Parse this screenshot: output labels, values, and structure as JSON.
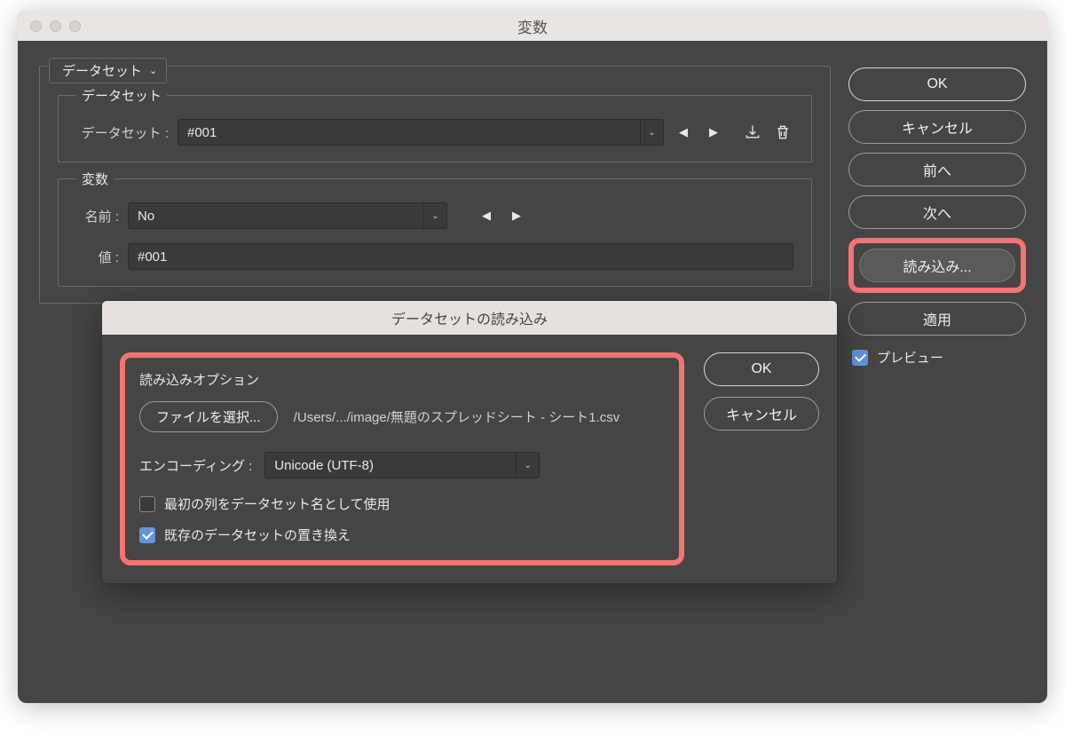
{
  "window": {
    "title": "変数"
  },
  "tab": {
    "label": "データセット",
    "has_menu": true
  },
  "dataset_group": {
    "legend": "データセット",
    "field_label": "データセット :",
    "value": "#001"
  },
  "variable_group": {
    "legend": "変数",
    "name_label": "名前 :",
    "name_value": "No",
    "value_label": "値 :",
    "value_value": "#001"
  },
  "sidebar": {
    "ok": "OK",
    "cancel": "キャンセル",
    "prev": "前へ",
    "next": "次へ",
    "import": "読み込み...",
    "apply": "適用",
    "preview_label": "プレビュー",
    "preview_checked": true
  },
  "modal": {
    "title": "データセットの読み込み",
    "options_legend": "読み込みオプション",
    "choose_file": "ファイルを選択...",
    "filepath": "/Users/.../image/無題のスプレッドシート - シート1.csv",
    "encoding_label": "エンコーディング :",
    "encoding_value": "Unicode (UTF-8)",
    "use_first_col": "最初の列をデータセット名として使用",
    "use_first_col_checked": false,
    "replace_existing": "既存のデータセットの置き換え",
    "replace_existing_checked": true,
    "ok": "OK",
    "cancel": "キャンセル"
  }
}
